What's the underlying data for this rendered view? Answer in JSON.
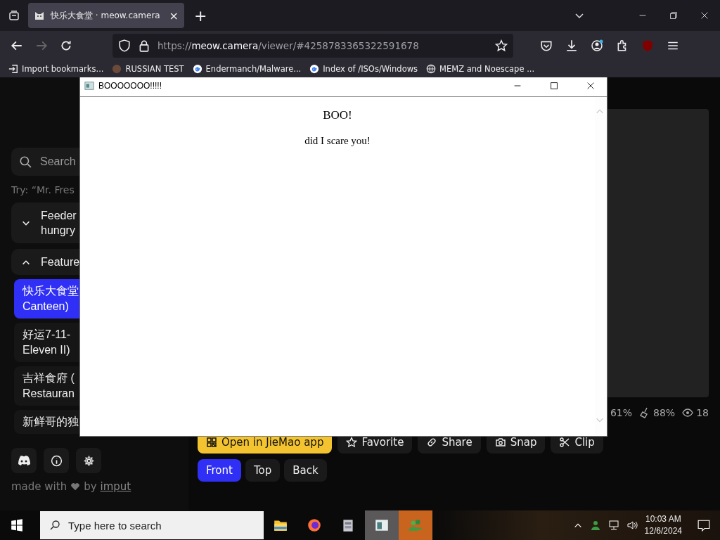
{
  "browser": {
    "tab": {
      "title": "快乐大食堂 · meow.camera",
      "close": "×"
    },
    "new_tab": "+",
    "nav": {
      "back_disabled": false,
      "forward_disabled": true,
      "url_prefix": "https://",
      "url_host": "meow.camera",
      "url_path": "/viewer/#4258783365322591678"
    },
    "bookmarks": [
      {
        "label": "Import bookmarks..."
      },
      {
        "label": "RUSSIAN TEST"
      },
      {
        "label": "Endermanch/Malware..."
      },
      {
        "label": "Index of /ISOs/Windows"
      },
      {
        "label": "MEMZ and Noescape ..."
      }
    ]
  },
  "sidebar": {
    "search": {
      "placeholder": "Search"
    },
    "hint": "Try: “Mr. Fres",
    "sections": [
      {
        "title": "Feeder",
        "subtitle": "hungry",
        "expanded": false
      },
      {
        "title": "Feature",
        "expanded": true,
        "items": [
          {
            "lines": [
              "快乐大食堂",
              "Canteen)"
            ],
            "selected": true
          },
          {
            "lines": [
              "好运7-11-",
              "Eleven II)"
            ],
            "selected": false
          },
          {
            "lines": [
              "吉祥食府 (",
              "Restauran"
            ],
            "selected": false
          },
          {
            "lines": [
              "新鲜哥的独"
            ],
            "selected": false
          }
        ]
      }
    ],
    "footer": {
      "made": "made with",
      "by": "by",
      "link": "imput"
    }
  },
  "stats": [
    {
      "value": "61%"
    },
    {
      "value": "88%"
    },
    {
      "value": "18"
    }
  ],
  "actions": [
    {
      "label": "Open in JieMao app",
      "kind": "primary"
    },
    {
      "label": "Favorite",
      "kind": "plain"
    },
    {
      "label": "Share",
      "kind": "plain"
    },
    {
      "label": "Snap",
      "kind": "plain"
    },
    {
      "label": "Clip",
      "kind": "plain"
    }
  ],
  "views": [
    {
      "label": "Front",
      "selected": true
    },
    {
      "label": "Top",
      "selected": false
    },
    {
      "label": "Back",
      "selected": false
    }
  ],
  "popup": {
    "title": "BOOOOOOO!!!!!",
    "heading": "BOO!",
    "message": "did I scare you!"
  },
  "taskbar": {
    "search": {
      "placeholder": "Type here to search"
    },
    "apps": [
      {
        "active": false,
        "attention": false
      },
      {
        "active": false,
        "attention": false
      },
      {
        "active": false,
        "attention": false
      },
      {
        "active": true,
        "attention": false
      },
      {
        "active": false,
        "attention": true
      }
    ],
    "time": "10:03 AM",
    "date": "12/6/2024"
  }
}
